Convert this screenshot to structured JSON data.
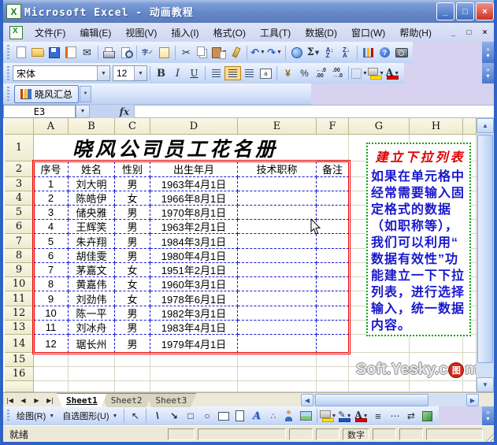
{
  "window": {
    "title": "Microsoft Excel - 动画教程",
    "controls": {
      "minimize": "_",
      "restore": "□",
      "close": "×"
    }
  },
  "menu": {
    "items": [
      "文件(F)",
      "编辑(E)",
      "视图(V)",
      "插入(I)",
      "格式(O)",
      "工具(T)",
      "数据(D)",
      "窗口(W)",
      "帮助(H)"
    ],
    "window_controls": [
      "_",
      "□",
      "×"
    ]
  },
  "toolbars": {
    "standard": [
      {
        "name": "new-icon",
        "glyph": ""
      },
      {
        "name": "open-icon",
        "glyph": ""
      },
      {
        "name": "save-icon",
        "glyph": ""
      },
      {
        "name": "permission-icon",
        "glyph": ""
      },
      {
        "name": "mail-icon",
        "glyph": "✉",
        "sep_after": true
      },
      {
        "name": "print-icon",
        "glyph": ""
      },
      {
        "name": "print-preview-icon",
        "glyph": "",
        "sep_after": true
      },
      {
        "name": "spelling-icon",
        "glyph": "字✓"
      },
      {
        "name": "research-icon",
        "glyph": "",
        "sep_after": true
      },
      {
        "name": "cut-icon",
        "glyph": "✂"
      },
      {
        "name": "copy-icon",
        "glyph": ""
      },
      {
        "name": "paste-icon",
        "glyph": "",
        "dropdown": true
      },
      {
        "name": "format-painter-icon",
        "glyph": "",
        "sep_after": true
      },
      {
        "name": "undo-icon",
        "glyph": "↶",
        "dropdown": true
      },
      {
        "name": "redo-icon",
        "glyph": "↷",
        "dropdown": true,
        "sep_after": true
      },
      {
        "name": "hyperlink-icon",
        "glyph": ""
      },
      {
        "name": "autosum-icon",
        "glyph": "Σ",
        "dropdown": true
      },
      {
        "name": "sort-asc-icon",
        "glyph": "A↓\nZ"
      },
      {
        "name": "sort-desc-icon",
        "glyph": "Z↓\nA",
        "sep_after": true
      },
      {
        "name": "chart-wizard-icon",
        "glyph": ""
      },
      {
        "name": "help-icon",
        "glyph": "?"
      },
      {
        "name": "camera-icon",
        "glyph": ""
      }
    ],
    "formatting": {
      "font_name": "宋体",
      "font_size": "12",
      "buttons": [
        {
          "name": "bold-icon",
          "glyph": "B"
        },
        {
          "name": "italic-icon",
          "glyph": "I"
        },
        {
          "name": "underline-icon",
          "glyph": "U",
          "sep_after": true
        },
        {
          "name": "align-left-icon",
          "glyph": ""
        },
        {
          "name": "align-center-icon",
          "glyph": "",
          "selected": true
        },
        {
          "name": "align-right-icon",
          "glyph": ""
        },
        {
          "name": "merge-center-icon",
          "glyph": "a",
          "sep_after": true
        },
        {
          "name": "currency-icon",
          "glyph": "¥"
        },
        {
          "name": "percent-icon",
          "glyph": "%"
        },
        {
          "name": "increase-decimal-icon",
          "glyph": "←.0\n.00"
        },
        {
          "name": "decrease-decimal-icon",
          "glyph": ".00\n→.0",
          "sep_after": true
        },
        {
          "name": "borders-icon",
          "glyph": "",
          "dropdown": true
        },
        {
          "name": "fill-color-icon",
          "glyph": "",
          "dropdown": true
        },
        {
          "name": "font-color-icon",
          "glyph": "A",
          "dropdown": true
        }
      ]
    },
    "custom_label": "晓风汇总",
    "drawing": {
      "draw_label": "绘图(R)",
      "shapes_label": "自选图形(U)",
      "icons": [
        {
          "name": "select-arrow-icon",
          "glyph": "↖",
          "sep_after": true
        },
        {
          "name": "line-icon",
          "glyph": "\\"
        },
        {
          "name": "arrow-icon",
          "glyph": "↘"
        },
        {
          "name": "rectangle-icon",
          "glyph": "□"
        },
        {
          "name": "oval-icon",
          "glyph": "○"
        },
        {
          "name": "textbox-icon",
          "glyph": ""
        },
        {
          "name": "vertical-textbox-icon",
          "glyph": ""
        },
        {
          "name": "wordart-icon",
          "glyph": "A"
        },
        {
          "name": "diagram-icon",
          "glyph": "∴"
        },
        {
          "name": "clipart-icon",
          "glyph": ""
        },
        {
          "name": "picture-icon",
          "glyph": "",
          "sep_after": true
        },
        {
          "name": "fill-color-icon",
          "glyph": "",
          "dropdown": true
        },
        {
          "name": "line-color-icon",
          "glyph": "✎",
          "dropdown": true
        },
        {
          "name": "font-color-icon",
          "glyph": "A",
          "dropdown": true
        },
        {
          "name": "line-style-icon",
          "glyph": "≡"
        },
        {
          "name": "dash-style-icon",
          "glyph": "⋯"
        },
        {
          "name": "arrow-style-icon",
          "glyph": "⇄"
        },
        {
          "name": "shadow-3d-icon",
          "glyph": ""
        }
      ]
    }
  },
  "formula_bar": {
    "name_box": "E3",
    "fx_label": "fx",
    "formula": ""
  },
  "grid": {
    "column_letters": [
      "A",
      "B",
      "C",
      "D",
      "E",
      "F",
      "G",
      "H"
    ],
    "row_numbers": [
      "1",
      "2",
      "3",
      "4",
      "5",
      "6",
      "7",
      "8",
      "9",
      "10",
      "11",
      "12",
      "13",
      "14",
      "15",
      "16"
    ],
    "sheet_title": "晓风公司员工花名册"
  },
  "table": {
    "headers": [
      "序号",
      "姓名",
      "性别",
      "出生年月",
      "技术职称",
      "备注"
    ],
    "rows": [
      [
        "1",
        "刘大明",
        "男",
        "1963年4月1日",
        "",
        ""
      ],
      [
        "2",
        "陈皓伊",
        "女",
        "1966年8月1日",
        "",
        ""
      ],
      [
        "3",
        "储央雅",
        "男",
        "1970年8月1日",
        "",
        ""
      ],
      [
        "4",
        "王辉笑",
        "男",
        "1963年2月1日",
        "",
        ""
      ],
      [
        "5",
        "朱卉翔",
        "男",
        "1984年3月1日",
        "",
        ""
      ],
      [
        "6",
        "胡佳雯",
        "男",
        "1980年4月1日",
        "",
        ""
      ],
      [
        "7",
        "茅嘉文",
        "女",
        "1951年2月1日",
        "",
        ""
      ],
      [
        "8",
        "黄嘉伟",
        "女",
        "1960年3月1日",
        "",
        ""
      ],
      [
        "9",
        "刘劲伟",
        "女",
        "1978年6月1日",
        "",
        ""
      ],
      [
        "10",
        "陈一平",
        "男",
        "1982年3月1日",
        "",
        ""
      ],
      [
        "11",
        "刘冰舟",
        "男",
        "1983年4月1日",
        "",
        ""
      ],
      [
        "12",
        "琚长州",
        "男",
        "1979年4月1日",
        "",
        ""
      ]
    ]
  },
  "note_box": {
    "title": "建立下拉列表",
    "lines": [
      "如果在单元格中",
      "经常需要输入固",
      "定格式的数据",
      "（如职称等），",
      "我们可以利用“",
      "数据有效性”功",
      "能建立一下下拉",
      "列表，进行选择",
      "输入，统一数据",
      "内容。"
    ],
    "border_color": "#00a000",
    "title_color": "#dd0000",
    "text_color": "#1818cc"
  },
  "watermark": {
    "prefix": "Soft.Yesky.c",
    "stamp_char": "图",
    "suffix": "m"
  },
  "sheet_tabs": {
    "nav": [
      "|◀",
      "◀",
      "▶",
      "▶|"
    ],
    "sheets": [
      "Sheet1",
      "Sheet2",
      "Sheet3"
    ],
    "active_index": 0
  },
  "status_bar": {
    "ready": "就绪",
    "num_indicator": "数字"
  },
  "colors": {
    "table_border": "#e80000",
    "grid_inner_border": "#1818cc",
    "header_bg": "#f5f2db",
    "title_bar": "#6688c8"
  }
}
